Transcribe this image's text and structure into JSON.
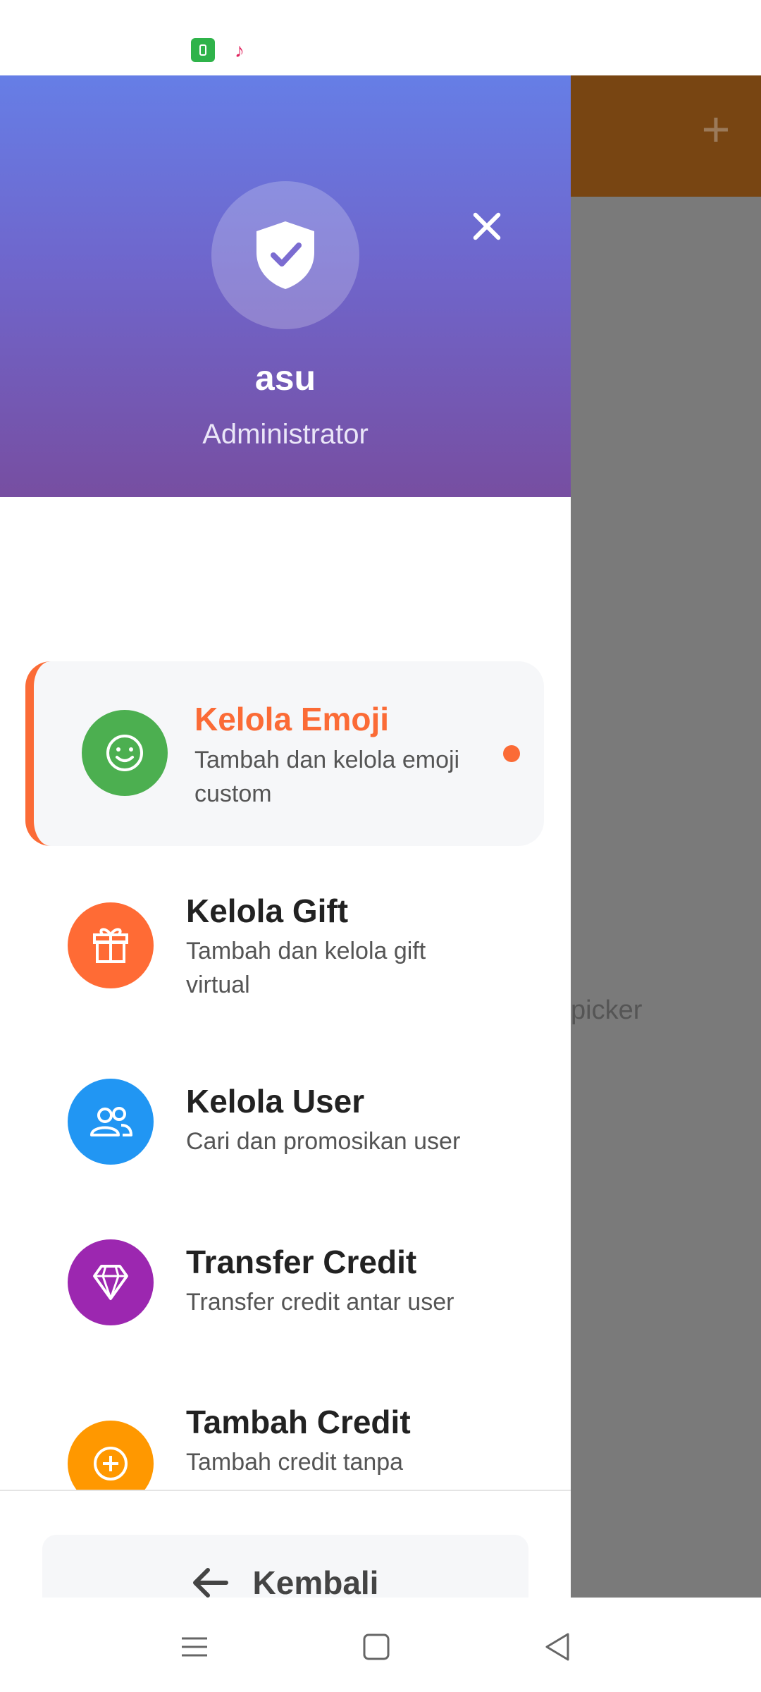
{
  "header": {
    "user_name": "asu",
    "user_role": "Administrator"
  },
  "menu": {
    "items": [
      {
        "title": "Kelola Emoji",
        "subtitle": "Tambah dan kelola emoji custom",
        "icon": "smiley-icon",
        "color": "#4caf50",
        "active": true
      },
      {
        "title": "Kelola Gift",
        "subtitle": "Tambah dan kelola gift virtual",
        "icon": "gift-icon",
        "color": "#ff6b35"
      },
      {
        "title": "Kelola User",
        "subtitle": "Cari dan promosikan user",
        "icon": "users-icon",
        "color": "#2196f3"
      },
      {
        "title": "Transfer Credit",
        "subtitle": "Transfer credit antar user",
        "icon": "diamond-icon",
        "color": "#9c27b0"
      },
      {
        "title": "Tambah Credit",
        "subtitle": "Tambah credit tanpa",
        "icon": "plus-circle-icon",
        "color": "#ff9800"
      }
    ]
  },
  "footer": {
    "back_label": "Kembali"
  },
  "background": {
    "partial_text": "picker"
  },
  "colors": {
    "accent": "#fb6b36",
    "header_gradient_start": "#667ee6",
    "header_gradient_end": "#774ea1"
  }
}
